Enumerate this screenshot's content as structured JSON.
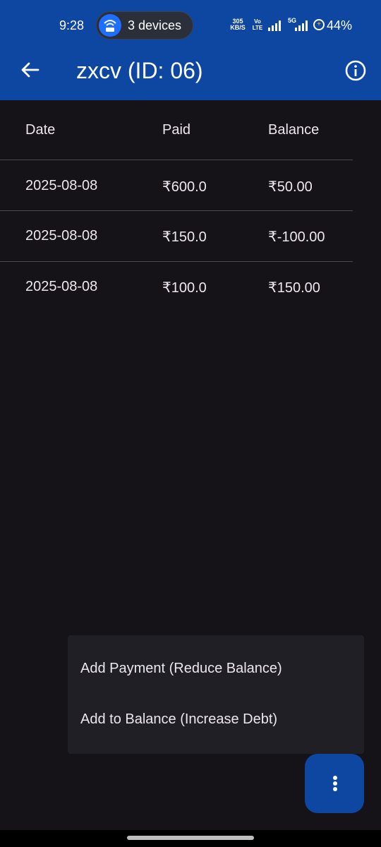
{
  "status_bar": {
    "time": "9:28",
    "hotspot_label": "3 devices",
    "net_speed_value": "305",
    "net_speed_unit": "KB/S",
    "volte_top": "Vo",
    "volte_bottom": "LTE",
    "network": "5G",
    "battery": "44%"
  },
  "app_bar": {
    "title": "zxcv (ID: 06)",
    "back_icon": "arrow-left-icon",
    "info_icon": "info-icon",
    "color": "#0D47A1"
  },
  "table": {
    "headers": [
      "Date",
      "Paid",
      "Balance"
    ],
    "rows": [
      {
        "date": "2025-08-08",
        "paid": "₹600.0",
        "balance": "₹50.00"
      },
      {
        "date": "2025-08-08",
        "paid": "₹150.0",
        "balance": "₹-100.00"
      },
      {
        "date": "2025-08-08",
        "paid": "₹100.0",
        "balance": "₹150.00"
      }
    ]
  },
  "menu": {
    "items": [
      {
        "label": "Add Payment (Reduce Balance)"
      },
      {
        "label": "Add to Balance (Increase Debt)"
      }
    ]
  },
  "fab": {
    "icon": "more-vertical-icon"
  }
}
